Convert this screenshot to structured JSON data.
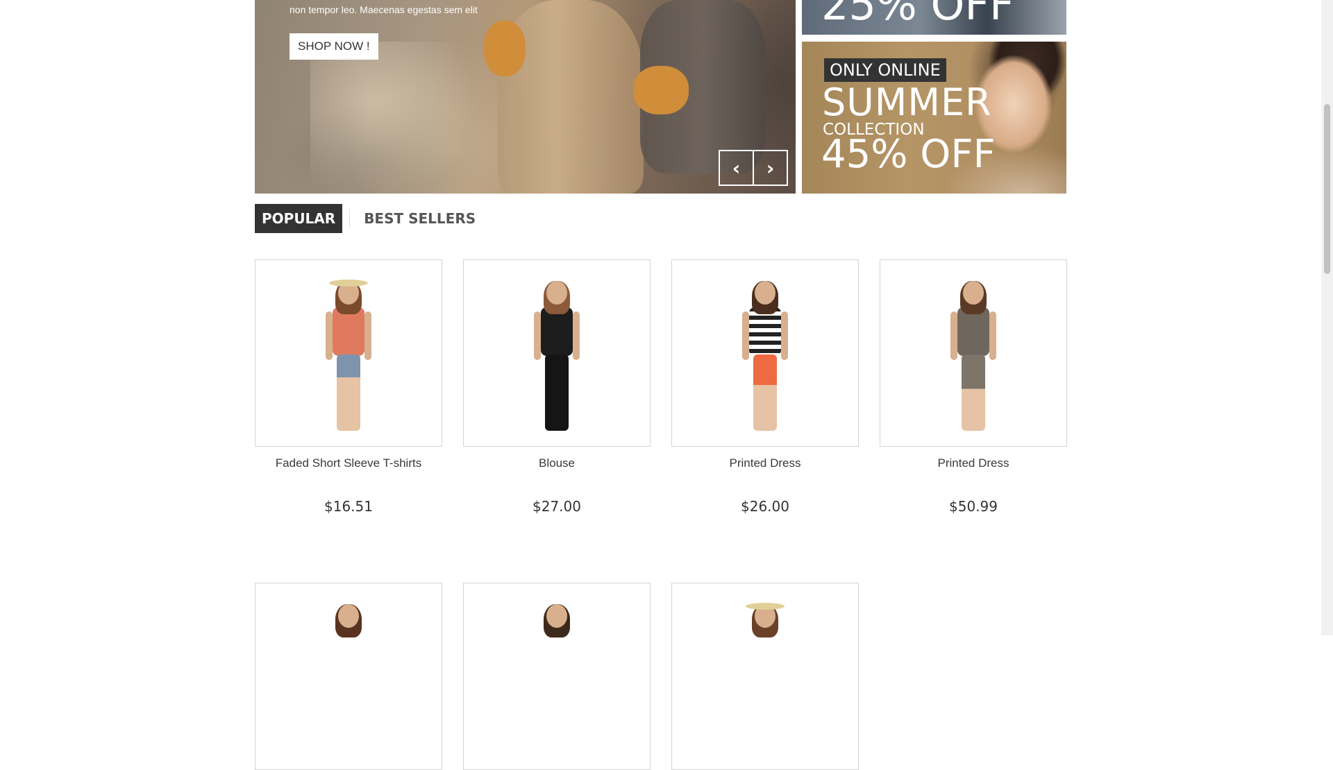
{
  "hero": {
    "text": "non tempor leo. Maecenas egestas sem elit",
    "shop_label": "SHOP NOW !",
    "prev_glyph": "‹",
    "next_glyph": "›"
  },
  "banner_top": {
    "text": "25% OFF"
  },
  "banner_bottom": {
    "tag": "ONLY ONLINE",
    "title": "SUMMER",
    "subtitle": "COLLECTION",
    "discount": "45% OFF"
  },
  "tabs": [
    {
      "label": "POPULAR",
      "active": true
    },
    {
      "label": "BEST SELLERS",
      "active": false
    }
  ],
  "products": [
    {
      "name": "Faded Short Sleeve T-shirts",
      "price": "$16.51"
    },
    {
      "name": "Blouse",
      "price": "$27.00"
    },
    {
      "name": "Printed Dress",
      "price": "$26.00"
    },
    {
      "name": "Printed Dress",
      "price": "$50.99"
    }
  ],
  "icons": {
    "prev": "chevron-left-icon",
    "next": "chevron-right-icon"
  },
  "colors": {
    "dark": "#333333",
    "border": "#d6d4d4",
    "text": "#3a3939"
  }
}
